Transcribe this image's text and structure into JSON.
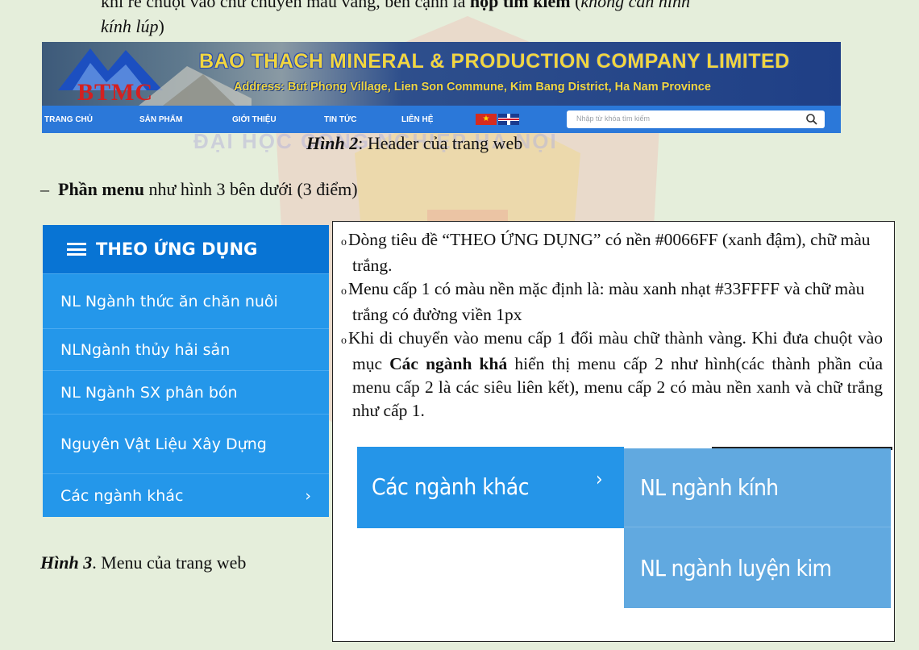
{
  "intro": {
    "line1_pre": "khi rê chuột vào chữ chuyển màu vàng, bên cạnh là ",
    "line1_bold": "hộp tìm kiếm",
    "line1_post": " (",
    "line1_italic": "không cần hình",
    "line2_italic": "kính lúp",
    "line2_post": ")"
  },
  "watermark": "ĐẠI HỌC CÔNG NGHIỆP HÀ NỘI",
  "header": {
    "logo": "BTMC",
    "company": "BAO THACH MINERAL & PRODUCTION COMPANY LIMITED",
    "address": "Address: But Phong Village, Lien Son Commune, Kim Bang District, Ha Nam Province",
    "nav": [
      "TRANG CHỦ",
      "SẢN PHẨM",
      "GIỚI THIỆU",
      "TIN TỨC",
      "LIÊN HỆ"
    ],
    "search_placeholder": "Nhập từ khóa tìm kiếm"
  },
  "caption2": {
    "label": "Hình 2",
    "text": ": Header của trang web"
  },
  "bullet": {
    "dash": "–",
    "bold": "Phần menu",
    "text": " như hình 3 bên dưới (3 điểm)"
  },
  "menu": {
    "title": "THEO ỨNG DỤNG",
    "items": [
      "NL Ngành thức ăn chăn nuôi",
      "NLNgành thủy hải sản",
      "NL Ngành SX phân bón",
      "Nguyên Vật Liệu Xây Dựng",
      "Các ngành khác"
    ],
    "chevron": "›"
  },
  "caption3": {
    "label": "Hình 3",
    "text": ". Menu của trang web"
  },
  "description": {
    "p1": "Dòng tiêu đề “THEO ỨNG DỤNG” có nền #0066FF (xanh đậm), chữ màu trắng.",
    "p2": "Menu cấp 1 có màu nền mặc định là: màu xanh nhạt #33FFFF  và chữ màu trắng có đường viền 1px",
    "p3_pre": "Khi di chuyển vào menu cấp 1 đổi màu chữ thành vàng. Khi đưa chuột vào mục ",
    "p3_bold": "Các ngành khá",
    "p3_post": " hiển thị menu cấp 2 như hình(các thành phần của menu cấp 2 là các siêu liên kết), menu cấp 2 có màu nền xanh và chữ trắng như cấp 1."
  },
  "submenu_example": {
    "parent": "Các ngành khác",
    "chevron": "›",
    "children": [
      "NL ngành kính",
      "NL ngành luyện kim"
    ]
  },
  "colors": {
    "page_bg": "#e5eedb",
    "menu_header": "#0874d4",
    "menu_item": "#2497ea",
    "navbar": "#2b78d9",
    "submenu": "#61a9e0",
    "company_text": "#f1d640",
    "logo_text": "#d42020"
  }
}
